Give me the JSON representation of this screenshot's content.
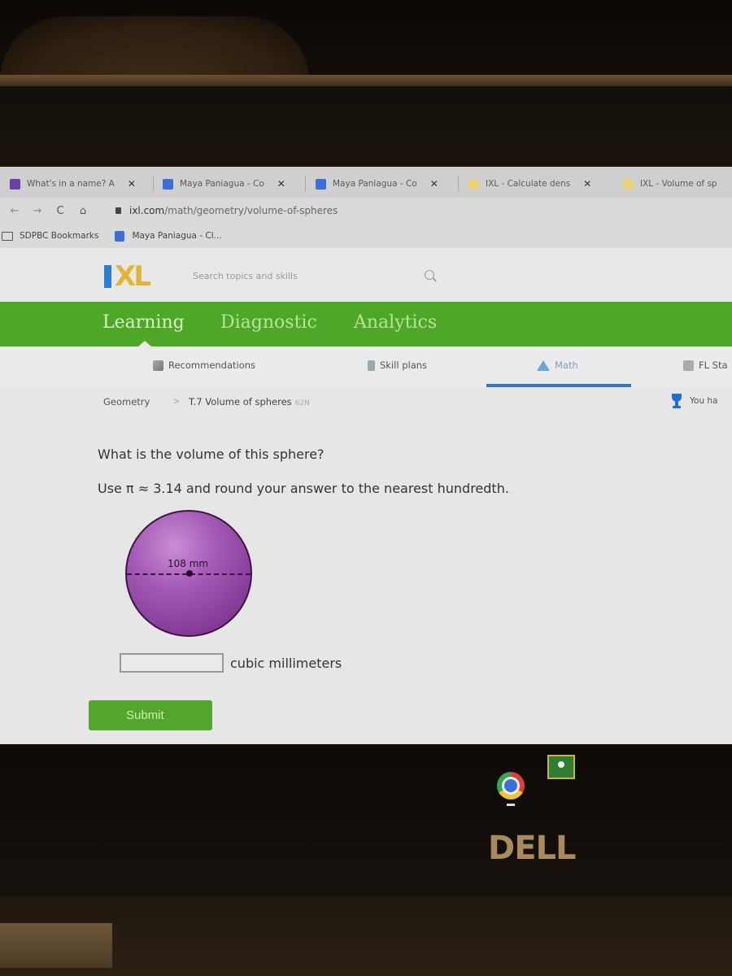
{
  "browser": {
    "tabs": [
      {
        "title": "What's in a name? A",
        "favicon": "forms-icon",
        "color": "#6a3fa0"
      },
      {
        "title": "Maya Paniagua - Co",
        "favicon": "docs-icon",
        "color": "#3b6fd6"
      },
      {
        "title": "Maya Paniagua - Co",
        "favicon": "docs-icon",
        "color": "#3b6fd6"
      },
      {
        "title": "IXL - Calculate dens",
        "favicon": "ixl-icon",
        "color": "#e9d37a"
      },
      {
        "title": "IXL - Volume of sp",
        "favicon": "ixl-icon",
        "color": "#e9d37a",
        "active": true
      }
    ],
    "close_glyph": "✕",
    "nav": {
      "back": "←",
      "forward": "→",
      "reload": "C",
      "home": "⌂"
    },
    "url": {
      "host": "ixl.com",
      "path": "/math/geometry/volume-of-spheres"
    },
    "bookmarks": [
      {
        "label": "SDPBC Bookmarks",
        "icon": "folder-icon"
      },
      {
        "label": "Maya Paniagua - Cl...",
        "icon": "docs-icon"
      }
    ]
  },
  "ixl": {
    "logo": {
      "i": "I",
      "xl": "XL"
    },
    "search_placeholder": "Search topics and skills",
    "main_nav": [
      "Learning",
      "Diagnostic",
      "Analytics"
    ],
    "active_main_nav": "Learning",
    "sub_nav": [
      {
        "label": "Recommendations",
        "icon": "recommendations-icon"
      },
      {
        "label": "Skill plans",
        "icon": "skill-plans-icon"
      },
      {
        "label": "Math",
        "icon": "math-icon",
        "active": true
      },
      {
        "label": "FL Sta",
        "icon": "standards-icon"
      }
    ],
    "breadcrumb": {
      "subject": "Geometry",
      "separator": ">",
      "skill": "T.7 Volume of spheres",
      "code": "62N"
    },
    "award_text": "You ha",
    "accent": "#4ea726"
  },
  "problem": {
    "question": "What is the volume of this sphere?",
    "instruction": "Use π ≈ 3.14 and round your answer to the nearest hundredth.",
    "diameter_label": "108 mm",
    "diameter_value": 108,
    "diameter_unit": "mm",
    "answer_value": "",
    "answer_unit": "cubic millimeters",
    "submit_label": "Submit"
  },
  "desktop": {
    "shelf_apps": [
      "Chrome",
      "Google Classroom"
    ],
    "brand": "DELL"
  }
}
